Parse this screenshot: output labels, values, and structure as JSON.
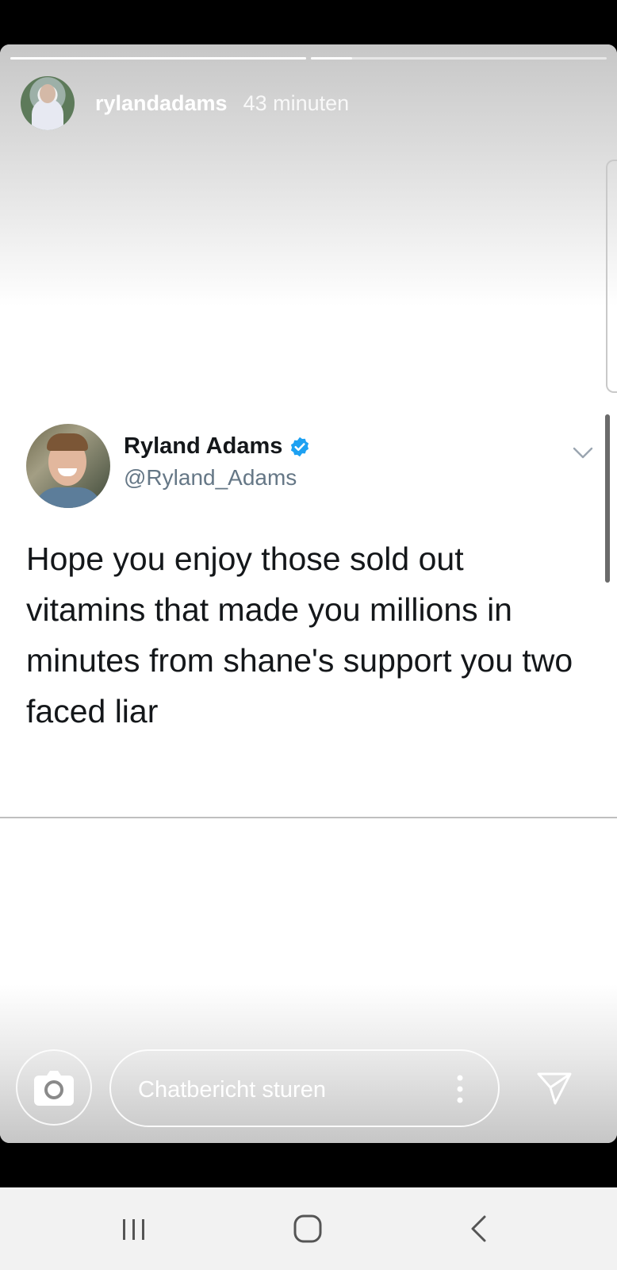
{
  "story": {
    "username": "rylandadams",
    "time": "43 minuten",
    "progress": [
      1.0,
      0.14
    ]
  },
  "tweet": {
    "name": "Ryland Adams",
    "handle": "@Ryland_Adams",
    "verified": true,
    "text": "Hope you enjoy those sold out vitamins that made you millions in minutes from shane's support you two faced liar"
  },
  "reply_bar": {
    "placeholder": "Chatbericht sturen"
  },
  "icons": {
    "camera": "camera-icon",
    "more": "more-vertical-icon",
    "send": "send-icon",
    "tweet_menu": "chevron-down-icon",
    "verified": "verified-badge-icon",
    "nav_recents": "recents-icon",
    "nav_home": "home-icon",
    "nav_back": "back-icon"
  },
  "colors": {
    "verified": "#1DA1F2",
    "tweet_text": "#14171A",
    "tweet_handle": "#657786"
  }
}
